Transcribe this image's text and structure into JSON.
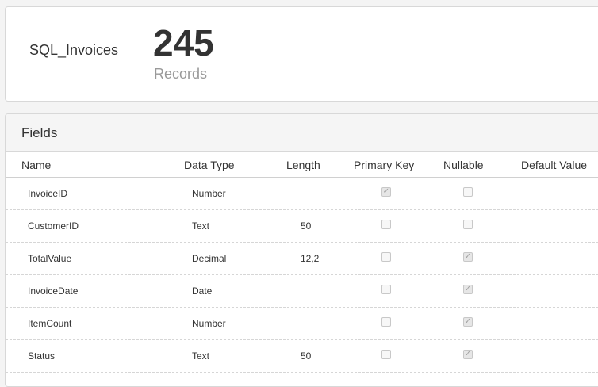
{
  "summary": {
    "table_name": "SQL_Invoices",
    "record_count": "245",
    "record_label": "Records"
  },
  "fields": {
    "title": "Fields",
    "columns": [
      "Name",
      "Data Type",
      "Length",
      "Primary Key",
      "Nullable",
      "Default Value"
    ],
    "rows": [
      {
        "name": "InvoiceID",
        "type": "Number",
        "length": "",
        "primary_key": true,
        "nullable": false
      },
      {
        "name": "CustomerID",
        "type": "Text",
        "length": "50",
        "primary_key": false,
        "nullable": false
      },
      {
        "name": "TotalValue",
        "type": "Decimal",
        "length": "12,2",
        "primary_key": false,
        "nullable": true
      },
      {
        "name": "InvoiceDate",
        "type": "Date",
        "length": "",
        "primary_key": false,
        "nullable": true
      },
      {
        "name": "ItemCount",
        "type": "Number",
        "length": "",
        "primary_key": false,
        "nullable": true
      },
      {
        "name": "Status",
        "type": "Text",
        "length": "50",
        "primary_key": false,
        "nullable": true
      }
    ]
  }
}
